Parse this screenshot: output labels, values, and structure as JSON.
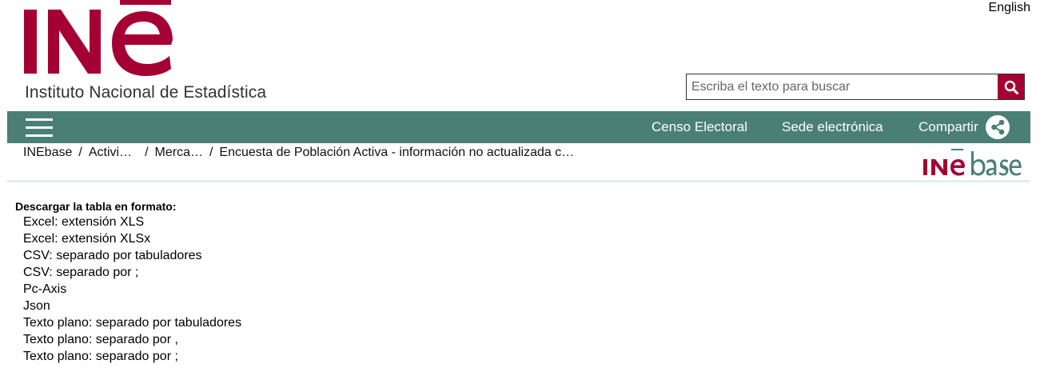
{
  "header": {
    "language_link": "English",
    "logo_subtitle": "Instituto Nacional de Estadística"
  },
  "search": {
    "placeholder": "Escriba el texto para buscar",
    "button_icon": "search-icon"
  },
  "nav": {
    "menu_icon": "hamburger-menu-icon",
    "items": [
      "Censo Electoral",
      "Sede electrónica",
      "Compartir"
    ],
    "share_icon": "share-icon"
  },
  "breadcrumb": [
    "INEbase",
    "Activi…",
    "Merca…",
    "Encuesta de Población Activa - información no actualizada c…"
  ],
  "download": {
    "title": "Descargar la tabla en formato:",
    "formats": [
      "Excel: extensión XLS",
      "Excel: extensión XLSx",
      "CSV: separado por tabuladores",
      "CSV: separado por ;",
      "Pc-Axis",
      "Json",
      "Texto plano: separado por tabuladores",
      "Texto plano: separado por ,",
      "Texto plano: separado por ;"
    ]
  },
  "colors": {
    "brand_red": "#a50034",
    "nav_green": "#4a7f76",
    "divider": "#e3eeec"
  }
}
